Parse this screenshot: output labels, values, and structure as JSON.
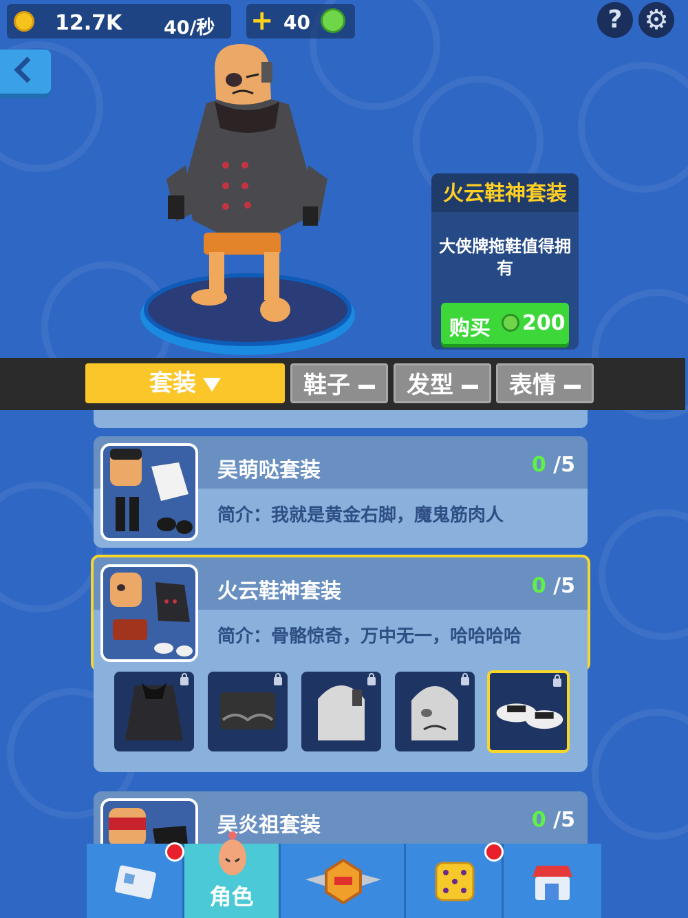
{
  "currency": {
    "coins": "12.7K",
    "coin_rate": "40/秒",
    "gems": "40"
  },
  "icons": {
    "coin": "coin-icon",
    "plus": "plus-icon",
    "gem": "gem-icon",
    "help": "help-icon",
    "settings": "gear-icon",
    "back": "back-arrow-icon"
  },
  "header": {
    "help_label": "?",
    "settings_label": "⚙"
  },
  "promo": {
    "title": "火云鞋神套装",
    "description": "大侠牌拖鞋值得拥有",
    "buy_label": "购买",
    "price": "200"
  },
  "tabs": [
    {
      "label": "套装",
      "active": true
    },
    {
      "label": "鞋子",
      "active": false
    },
    {
      "label": "发型",
      "active": false
    },
    {
      "label": "表情",
      "active": false
    }
  ],
  "outfits": [
    {
      "name": "吴萌哒套装",
      "owned": "0",
      "total": "/5",
      "desc": "简介：我就是黄金右脚，魔鬼筋肉人"
    },
    {
      "name": "火云鞋神套装",
      "owned": "0",
      "total": "/5",
      "desc": "简介：骨骼惊奇，万中无一，哈哈哈哈",
      "selected": true
    },
    {
      "name": "吴炎祖套装",
      "owned": "0",
      "total": "/5",
      "desc": ""
    }
  ],
  "parts": [
    {
      "name": "coat",
      "locked": true
    },
    {
      "name": "shorts",
      "locked": true
    },
    {
      "name": "hair",
      "locked": true
    },
    {
      "name": "face",
      "locked": true
    },
    {
      "name": "slippers",
      "locked": true,
      "selected": true
    }
  ],
  "bottom_nav": [
    {
      "icon": "news-icon",
      "label": "",
      "badge": true
    },
    {
      "icon": "character-icon",
      "label": "角色",
      "active": true
    },
    {
      "icon": "rank-badge-icon",
      "label": ""
    },
    {
      "icon": "dice-icon",
      "label": "",
      "badge": true
    },
    {
      "icon": "shop-icon",
      "label": ""
    }
  ],
  "colors": {
    "background": "#2f67c4",
    "accent_yellow": "#fbc62a",
    "buy_green": "#3dd73a",
    "owned_green": "#5ff245"
  }
}
